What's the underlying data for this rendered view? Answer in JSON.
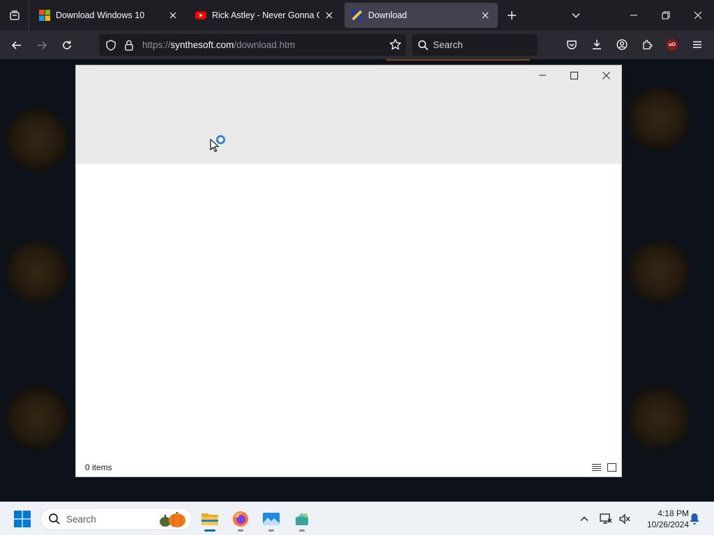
{
  "browser": {
    "tabs": [
      {
        "title": "Download Windows 10",
        "favicon": "windows-logo-icon",
        "active": false
      },
      {
        "title": "Rick Astley - Never Gonna Give",
        "favicon": "youtube-icon",
        "active": false
      },
      {
        "title": "Download",
        "favicon": "synthesoft-icon",
        "active": true
      }
    ],
    "url": {
      "scheme": "https://",
      "domain": "synthesoft.com",
      "path": "/download.htm"
    },
    "search_placeholder": "Search"
  },
  "explorer": {
    "status_count": "0 items",
    "state": "loading"
  },
  "taskbar": {
    "search_placeholder": "Search",
    "apps": [
      "file-explorer-icon",
      "firefox-icon",
      "photos-icon",
      "extra-app-icon"
    ],
    "time": "4:18 PM",
    "date": "10/26/2024"
  },
  "colors": {
    "accent": "#0067c0",
    "browser_bg": "#1f1e25",
    "toolbar_bg": "#2b2a33",
    "spinner": "#2f86d6"
  }
}
